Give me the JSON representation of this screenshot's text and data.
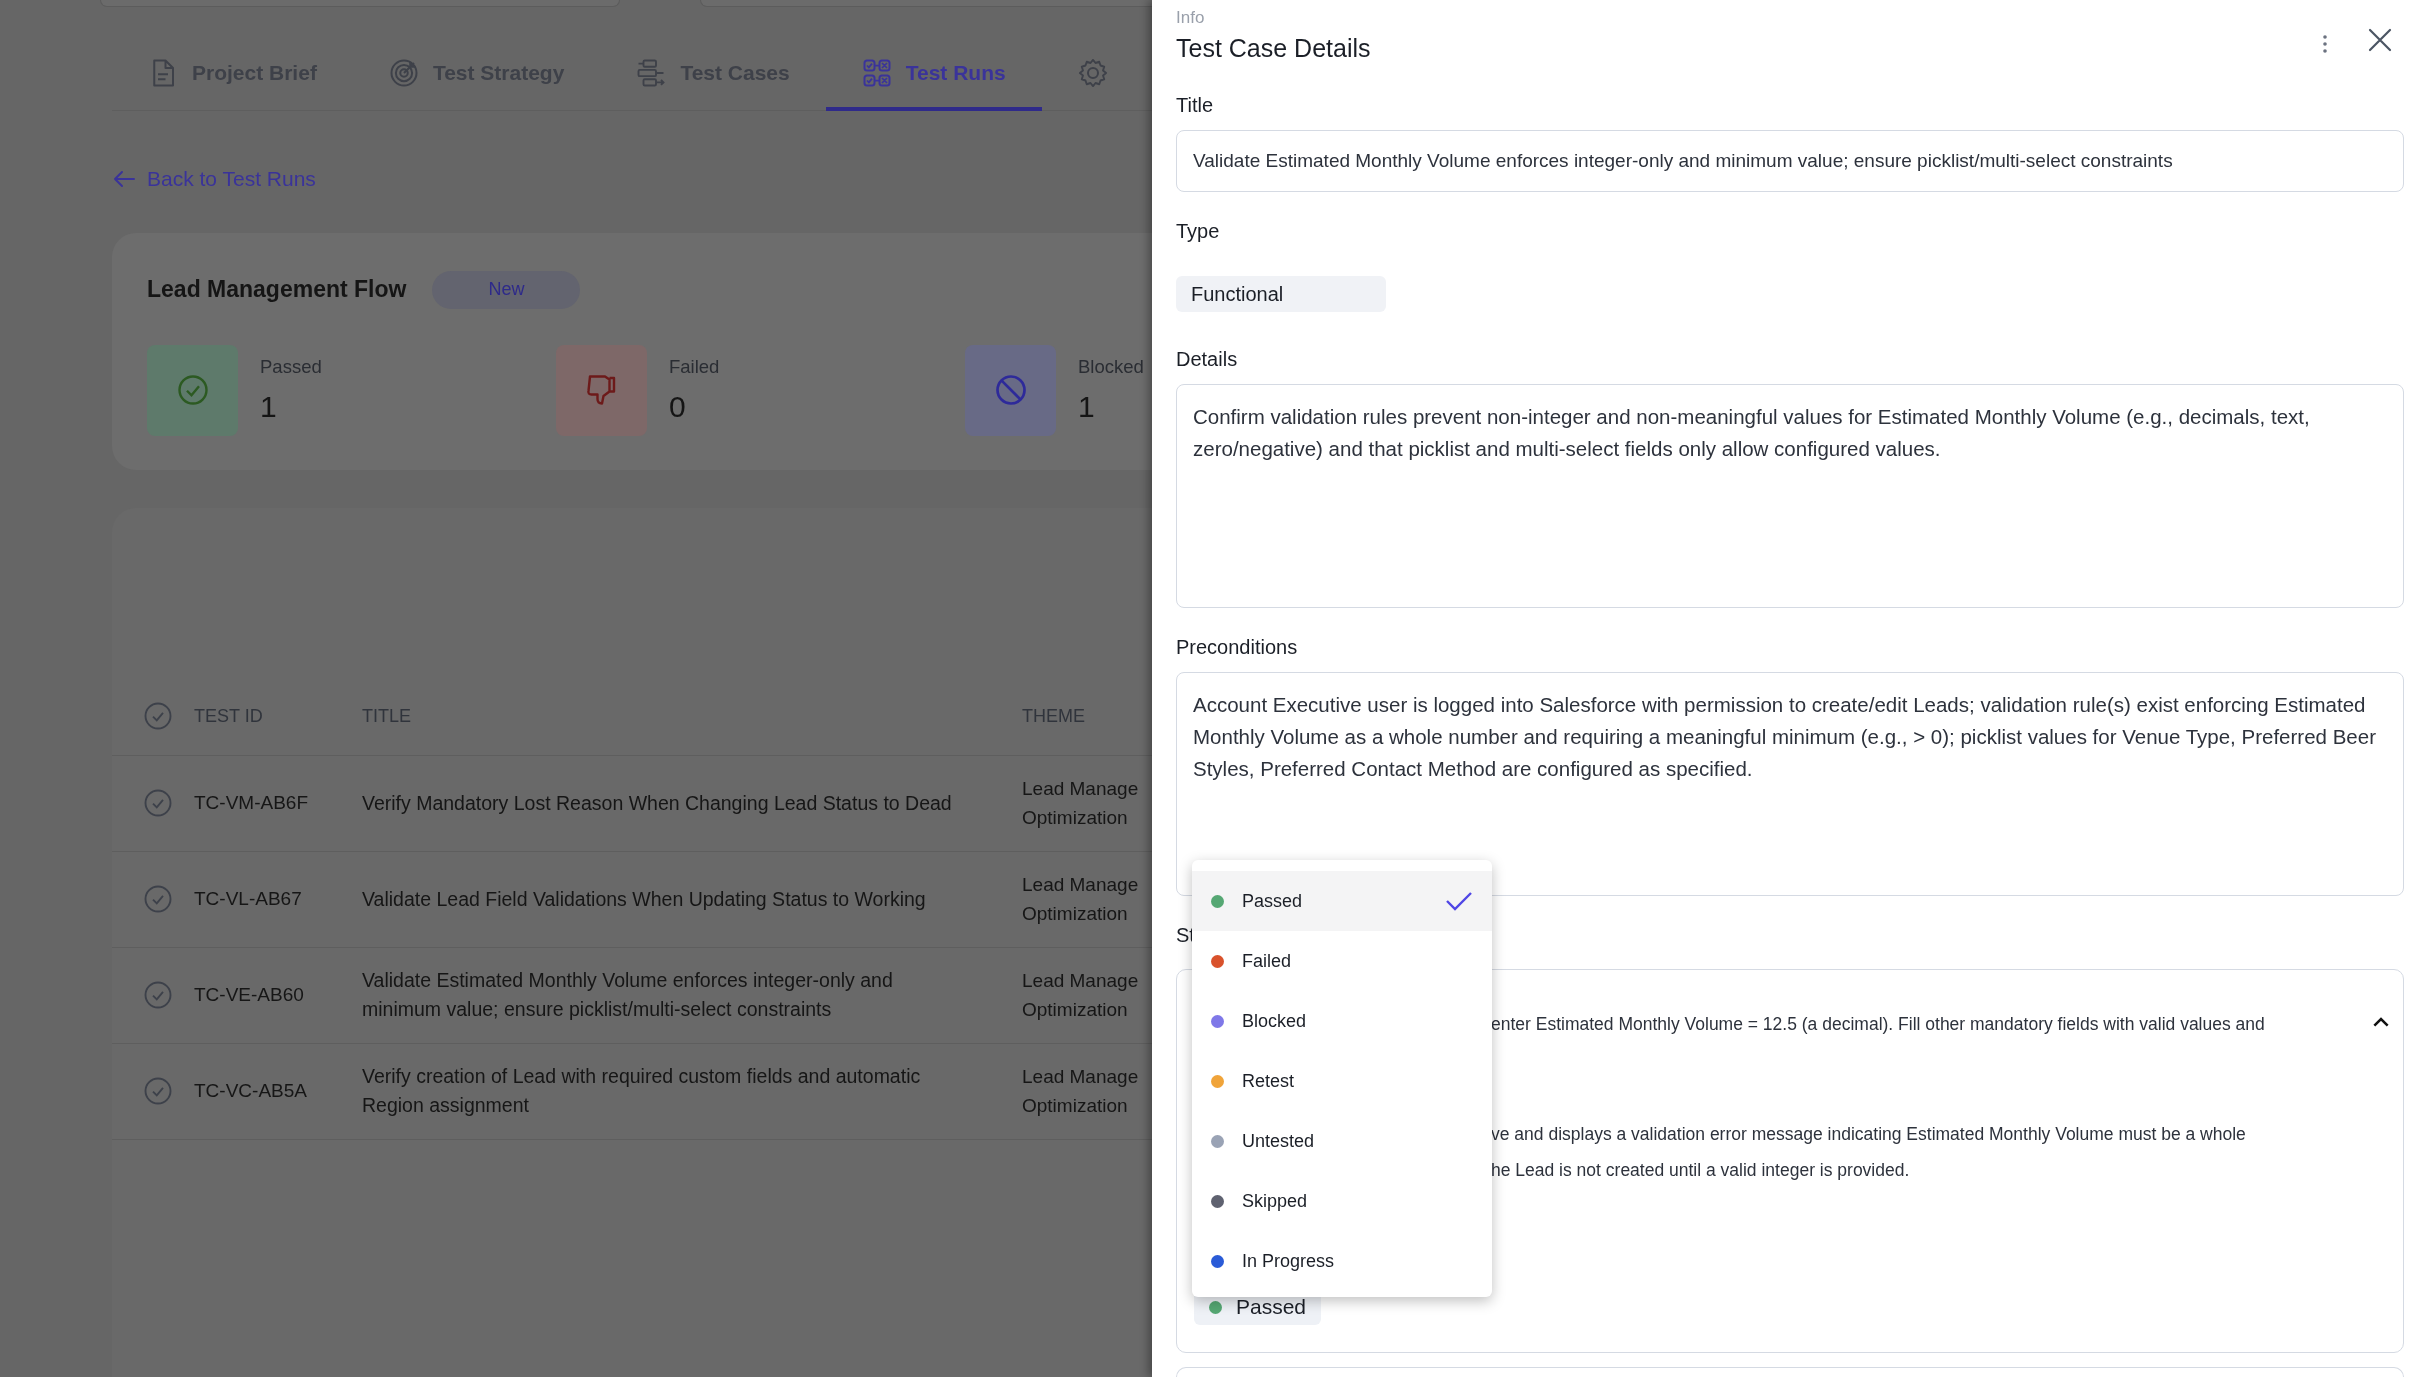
{
  "tabs": [
    {
      "label": "Project Brief",
      "kind": "document",
      "selected": false
    },
    {
      "label": "Test Strategy",
      "kind": "target",
      "selected": false
    },
    {
      "label": "Test Cases",
      "kind": "flow",
      "selected": false
    },
    {
      "label": "Test Runs",
      "kind": "runs",
      "selected": true
    },
    {
      "kind": "gear",
      "selected": false
    }
  ],
  "back_link": "Back to Test Runs",
  "run": {
    "title": "Lead Management Flow",
    "badge": "New",
    "stats": [
      {
        "kind": "passed",
        "label": "Passed",
        "value": "1"
      },
      {
        "kind": "failed",
        "label": "Failed",
        "value": "0"
      },
      {
        "kind": "blocked",
        "label": "Blocked",
        "value": "1"
      }
    ]
  },
  "table": {
    "columns": [
      "TEST ID",
      "TITLE",
      "THEME"
    ],
    "rows": [
      {
        "test_id": "TC-VM-AB6F",
        "title": "Verify Mandatory Lost Reason When Changing Lead Status to Dead",
        "theme": [
          "Lead Manage",
          "Optimization"
        ]
      },
      {
        "test_id": "TC-VL-AB67",
        "title": "Validate Lead Field Validations When Updating Status to Working",
        "theme": [
          "Lead Manage",
          "Optimization"
        ]
      },
      {
        "test_id": "TC-VE-AB60",
        "title": "Validate Estimated Monthly Volume enforces integer-only and minimum value; ensure picklist/multi-select constraints",
        "theme": [
          "Lead Manage",
          "Optimization"
        ]
      },
      {
        "test_id": "TC-VC-AB5A",
        "title": "Verify creation of Lead with required custom fields and automatic Region assignment",
        "theme": [
          "Lead Manage",
          "Optimization"
        ]
      }
    ]
  },
  "panel": {
    "overline": "Info",
    "title": "Test Case Details",
    "fields": [
      {
        "kind": "input",
        "label": "Title",
        "value": "Validate Estimated Monthly Volume enforces integer-only and minimum value; ensure picklist/multi-select constraints"
      },
      {
        "kind": "chip",
        "label": "Type",
        "value": "Functional"
      },
      {
        "kind": "textarea",
        "label": "Details",
        "value": "Confirm validation rules prevent non-integer and non-meaningful values for Estimated Monthly Volume (e.g., decimals, text, zero/negative) and that picklist and multi-select fields only allow configured values."
      },
      {
        "kind": "textarea",
        "label": "Preconditions",
        "value": "Account Executive user is logged into Salesforce with permission to create/edit Leads; validation rule(s) exist enforcing Estimated Monthly Volume as a whole number and requiring a meaningful minimum (e.g., > 0); picklist values for Venue Type, Preferred Beer Styles, Preferred Contact Method are configured as specified."
      }
    ],
    "steps": {
      "label": "St",
      "expanded": true,
      "action": "enter Estimated Monthly Volume = 12.5 (a decimal). Fill other mandatory fields with valid values and",
      "expected": [
        "ve and displays a validation error message indicating Estimated Monthly Volume must be a whole",
        "he Lead is not created until a valid integer is provided."
      ],
      "status": {
        "label": "Passed",
        "color": "#55a773"
      }
    },
    "status_menu": [
      {
        "label": "Passed",
        "color": "#55a773",
        "selected": true
      },
      {
        "label": "Failed",
        "color": "#d9522c",
        "selected": false
      },
      {
        "label": "Blocked",
        "color": "#7f78e8",
        "selected": false
      },
      {
        "label": "Retest",
        "color": "#f0a43a",
        "selected": false
      },
      {
        "label": "Untested",
        "color": "#9aa3b5",
        "selected": false
      },
      {
        "label": "Skipped",
        "color": "#5f6270",
        "selected": false
      },
      {
        "label": "In Progress",
        "color": "#2a5bd7",
        "selected": false
      }
    ]
  }
}
